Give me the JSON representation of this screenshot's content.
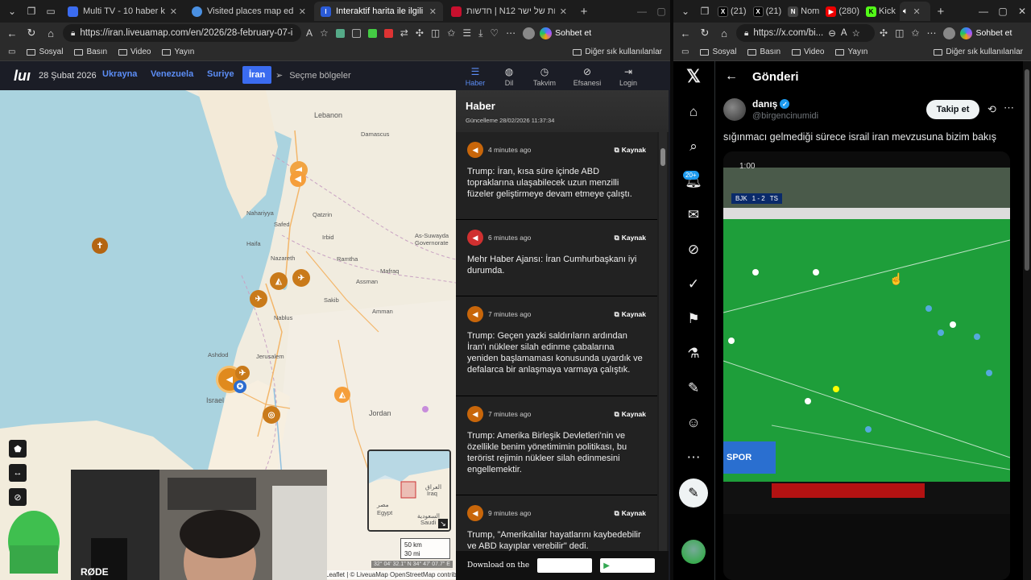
{
  "left_browser": {
    "tabs": [
      {
        "title": "Multi TV - 10 haber kanalını a",
        "favicon_color": "#3b6cf0",
        "active": false
      },
      {
        "title": "Visited places map editor",
        "favicon_color": "#4a90e2",
        "active": false
      },
      {
        "title": "Interaktif harita ile ilgili son İran ha",
        "favicon_color": "#2b5bd7",
        "active": true
      },
      {
        "title": "חדשות | N12 אתר החדשות של ישר",
        "favicon_color": "#c8102e",
        "active": false
      }
    ],
    "url": "https://iran.liveuamap.com/en/2026/28-february-07-israel-is...",
    "chat_label": "Sohbet et",
    "bookmarks": [
      "Sosyal",
      "Basın",
      "Video",
      "Yayın"
    ],
    "other_bookmarks": "Diğer sık kullanılanlar"
  },
  "site": {
    "logo": "luı",
    "date": "28 Şubat 2026",
    "regions": [
      "Ukrayna",
      "Venezuela",
      "Suriye",
      "İran"
    ],
    "active_region": "İran",
    "select_regions": "Seçme bölgeler",
    "nav_tabs": [
      {
        "label": "Haber",
        "icon": "list-icon",
        "active": true
      },
      {
        "label": "Dil",
        "icon": "globe-icon",
        "active": false
      },
      {
        "label": "Takvim",
        "icon": "clock-icon",
        "active": false
      },
      {
        "label": "Efsanesi",
        "icon": "compass-icon",
        "active": false
      },
      {
        "label": "Login",
        "icon": "login-icon",
        "active": false
      }
    ]
  },
  "map": {
    "labels": [
      "Lebanon",
      "Damascus",
      "Nahariyya",
      "Safed",
      "Qatzrin",
      "Haifa",
      "As-Suwayda Governorate",
      "Ramtha",
      "Irbid",
      "Nazareth",
      "Assman",
      "Mafraq",
      "Sakib",
      "Nablus",
      "Amman",
      "Ashdod",
      "Jerusalem",
      "Israel",
      "Jordan",
      "مصر",
      "Egypt",
      "العراق",
      "Iraq",
      "السعودية",
      "Saudi"
    ],
    "scale": [
      "50 km",
      "30 mi"
    ],
    "coords": "32° 04' 32.1\" N 34° 47' 07.7\" E",
    "attribution": "Leaflet | © LiveuaMap OpenStreetMap contributors"
  },
  "news": {
    "title": "Haber",
    "updated": "Güncelleme 28/02/2026 11:37:34",
    "source_label": "Kaynak",
    "items": [
      {
        "ago": "4 minutes ago",
        "icon_color": "#c8660a",
        "text": "Trump: İran, kısa süre içinde ABD topraklarına ulaşabilecek uzun menzilli füzeler geliştirmeye devam etmeye çalıştı."
      },
      {
        "ago": "6 minutes ago",
        "icon_color": "#d03030",
        "text": "Mehr Haber Ajansı: İran Cumhurbaşkanı iyi durumda."
      },
      {
        "ago": "7 minutes ago",
        "icon_color": "#c8660a",
        "text": "Trump: Geçen yazki saldırıların ardından İran'ı nükleer silah edinme çabalarına yeniden başlamaması konusunda uyardık ve defalarca bir anlaşmaya varmaya çalıştık."
      },
      {
        "ago": "7 minutes ago",
        "icon_color": "#c8660a",
        "text": "Trump: Amerika Birleşik Devletleri'nin ve özellikle benim yönetimimin politikası, bu terörist rejimin nükleer silah edinmesini engellemektir."
      },
      {
        "ago": "9 minutes ago",
        "icon_color": "#c8660a",
        "text": "Trump, \"Amerikalılar hayatlarını kaybedebilir ve ABD kayıplar verebilir\" dedi."
      }
    ],
    "store_text": "Download on the"
  },
  "right_browser": {
    "tabs": [
      {
        "title": "(21)",
        "favicon": "X"
      },
      {
        "title": "(21)",
        "favicon": "X"
      },
      {
        "title": "Nom",
        "favicon": "N"
      },
      {
        "title": "(280)",
        "favicon": "▶"
      },
      {
        "title": "Kick",
        "favicon": "K"
      }
    ],
    "url": "https://x.com/bi...",
    "chat_label": "Sohbet et",
    "bookmarks": [
      "Sosyal",
      "Basın",
      "Video",
      "Yayın"
    ],
    "other_bookmarks": "Diğer sık kullanılanlar"
  },
  "x": {
    "notifications_badge": "20+",
    "page_title": "Gönderi",
    "display_name": "danış",
    "handle": "@birgencinumidi",
    "follow_label": "Takip et",
    "post_text": "sığınmacı gelmediği sürece israil iran mevzusuna bizim bakış",
    "video_time": "1:00",
    "scoreboard": {
      "home": "BJK",
      "score": "1 - 2",
      "away": "TS"
    },
    "channel": "SPOR"
  },
  "colors": {
    "accent_blue": "#3b6cf0",
    "x_blue": "#1d9bf0",
    "marker_orange": "#e08a1e"
  }
}
